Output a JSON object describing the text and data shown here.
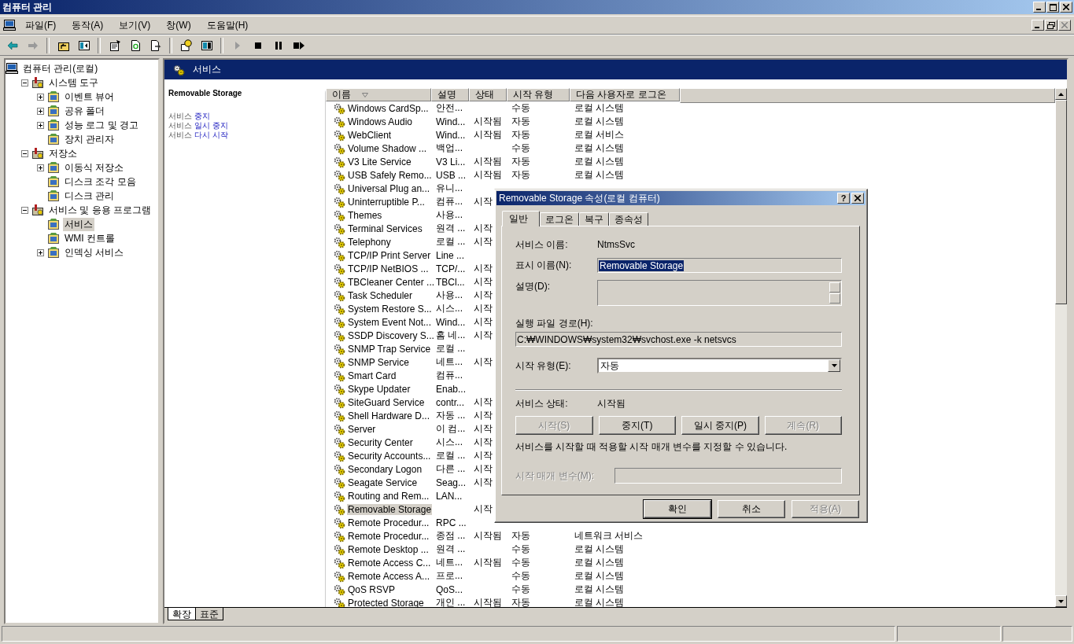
{
  "window": {
    "title": "컴퓨터 관리"
  },
  "menu": [
    "파일(F)",
    "동작(A)",
    "보기(V)",
    "창(W)",
    "도움말(H)"
  ],
  "toolbar": [
    {
      "disabled": false
    },
    {
      "disabled": true
    },
    {
      "disabled": false
    },
    {
      "disabled": false
    },
    {
      "disabled": false
    },
    {
      "disabled": false
    },
    {
      "disabled": false
    },
    {
      "disabled": false
    },
    {
      "disabled": false
    },
    {
      "disabled": true
    },
    {
      "disabled": false
    },
    {
      "disabled": false
    },
    {
      "disabled": false
    }
  ],
  "tree": [
    {
      "label": "컴퓨터 관리(로컬)",
      "selected": false,
      "children": [
        {
          "label": "시스템 도구",
          "expanded": true,
          "selected": false,
          "children": [
            {
              "label": "이벤트 뷰어",
              "expanded": false,
              "selected": false
            },
            {
              "label": "공유 폴더",
              "expanded": false,
              "selected": false
            },
            {
              "label": "성능 로그 및 경고",
              "expanded": false,
              "selected": false
            },
            {
              "label": "장치 관리자",
              "selected": false
            }
          ]
        },
        {
          "label": "저장소",
          "expanded": true,
          "selected": false,
          "children": [
            {
              "label": "이동식 저장소",
              "expanded": false,
              "selected": false
            },
            {
              "label": "디스크 조각 모음",
              "selected": false
            },
            {
              "label": "디스크 관리",
              "selected": false
            }
          ]
        },
        {
          "label": "서비스 및 응용 프로그램",
          "expanded": true,
          "selected": false,
          "children": [
            {
              "label": "서비스",
              "selected": true
            },
            {
              "label": "WMI 컨트롤",
              "selected": false
            },
            {
              "label": "인덱싱 서비스",
              "expanded": false,
              "selected": false
            }
          ]
        }
      ]
    }
  ],
  "pane_header": {
    "title": "서비스"
  },
  "description_pane": {
    "title": "Removable Storage",
    "links": [
      {
        "text": "서비스",
        "action": "중지"
      },
      {
        "text": "서비스",
        "action": "일시 중지"
      },
      {
        "text": "서비스",
        "action": "다시 시작"
      }
    ]
  },
  "table": {
    "columns": [
      {
        "label": "이름",
        "sorted": true
      },
      {
        "label": "설명",
        "sorted": false
      },
      {
        "label": "상태",
        "sorted": false
      },
      {
        "label": "시작 유형",
        "sorted": false
      },
      {
        "label": "다음 사용자로 로그온",
        "sorted": false
      }
    ],
    "rows": [
      {
        "name": "Windows CardSp...",
        "description": "안전...",
        "start_type": "수동",
        "logon": "로컬 시스템",
        "selected": false
      },
      {
        "name": "Windows Audio",
        "description": "Wind...",
        "status": "시작됨",
        "start_type": "자동",
        "logon": "로컬 시스템",
        "selected": false
      },
      {
        "name": "WebClient",
        "description": "Wind...",
        "status": "시작됨",
        "start_type": "자동",
        "logon": "로컬 서비스",
        "selected": false
      },
      {
        "name": "Volume Shadow ...",
        "description": "백업...",
        "start_type": "수동",
        "logon": "로컬 시스템",
        "selected": false
      },
      {
        "name": "V3 Lite Service",
        "description": "V3 Li...",
        "status": "시작됨",
        "start_type": "자동",
        "logon": "로컬 시스템",
        "selected": false
      },
      {
        "name": "USB Safely Remo...",
        "description": "USB ...",
        "status": "시작됨",
        "start_type": "자동",
        "logon": "로컬 시스템",
        "selected": false
      },
      {
        "name": "Universal Plug an...",
        "description": "유니...",
        "selected": false
      },
      {
        "name": "Uninterruptible P...",
        "description": "컴퓨...",
        "status": "시작",
        "selected": false
      },
      {
        "name": "Themes",
        "description": "사용...",
        "selected": false
      },
      {
        "name": "Terminal Services",
        "description": "원격 ...",
        "status": "시작",
        "selected": false
      },
      {
        "name": "Telephony",
        "description": "로컬 ...",
        "status": "시작",
        "selected": false
      },
      {
        "name": "TCP/IP Print Server",
        "description": "Line ...",
        "selected": false
      },
      {
        "name": "TCP/IP NetBIOS ...",
        "description": "TCP/...",
        "status": "시작",
        "selected": false
      },
      {
        "name": "TBCleaner Center ...",
        "description": "TBCl...",
        "status": "시작",
        "selected": false
      },
      {
        "name": "Task Scheduler",
        "description": "사용...",
        "status": "시작",
        "selected": false
      },
      {
        "name": "System Restore S...",
        "description": "시스...",
        "status": "시작",
        "selected": false
      },
      {
        "name": "System Event Not...",
        "description": "Wind...",
        "status": "시작",
        "selected": false
      },
      {
        "name": "SSDP Discovery S...",
        "description": "홈 네...",
        "status": "시작",
        "selected": false
      },
      {
        "name": "SNMP Trap Service",
        "description": "로컬 ...",
        "selected": false
      },
      {
        "name": "SNMP Service",
        "description": "네트...",
        "status": "시작",
        "selected": false
      },
      {
        "name": "Smart Card",
        "description": "컴퓨...",
        "selected": false
      },
      {
        "name": "Skype Updater",
        "description": "Enab...",
        "selected": false
      },
      {
        "name": "SiteGuard Service",
        "description": "contr...",
        "status": "시작",
        "selected": false
      },
      {
        "name": "Shell Hardware D...",
        "description": "자동 ...",
        "status": "시작",
        "selected": false
      },
      {
        "name": "Server",
        "description": "이 컴...",
        "status": "시작",
        "selected": false
      },
      {
        "name": "Security Center",
        "description": "시스...",
        "status": "시작",
        "selected": false
      },
      {
        "name": "Security Accounts...",
        "description": "로컬 ...",
        "status": "시작",
        "selected": false
      },
      {
        "name": "Secondary Logon",
        "description": "다른 ...",
        "status": "시작",
        "selected": false
      },
      {
        "name": "Seagate Service",
        "description": "Seag...",
        "status": "시작",
        "selected": false
      },
      {
        "name": "Routing and Rem...",
        "description": "LAN...",
        "selected": false
      },
      {
        "name": "Removable Storage",
        "status": "시작",
        "selected": true
      },
      {
        "name": "Remote Procedur...",
        "description": "RPC ...",
        "selected": false
      },
      {
        "name": "Remote Procedur...",
        "description": "종점 ...",
        "status": "시작됨",
        "start_type": "자동",
        "logon": "네트워크 서비스",
        "selected": false
      },
      {
        "name": "Remote Desktop ...",
        "description": "원격 ...",
        "start_type": "수동",
        "logon": "로컬 시스템",
        "selected": false
      },
      {
        "name": "Remote Access C...",
        "description": "네트...",
        "status": "시작됨",
        "start_type": "수동",
        "logon": "로컬 시스템",
        "selected": false
      },
      {
        "name": "Remote Access A...",
        "description": "프로...",
        "start_type": "수동",
        "logon": "로컬 시스템",
        "selected": false
      },
      {
        "name": "QoS RSVP",
        "description": "QoS...",
        "start_type": "수동",
        "logon": "로컬 시스템",
        "selected": false
      },
      {
        "name": "Protected Storage",
        "description": "개인 ...",
        "status": "시작됨",
        "start_type": "자동",
        "logon": "로컬 시스템",
        "selected": false
      }
    ]
  },
  "view_tabs": [
    {
      "label": "확장",
      "selected": true
    },
    {
      "label": "표준",
      "selected": false
    }
  ],
  "dialog": {
    "title": "Removable Storage 속성(로컬 컴퓨터)",
    "help_button": "?",
    "tabs": [
      {
        "label": "일반",
        "selected": true
      },
      {
        "label": "로그온",
        "selected": false
      },
      {
        "label": "복구",
        "selected": false
      },
      {
        "label": "종속성",
        "selected": false
      }
    ],
    "service_name_label": "서비스 이름:",
    "service_name": "NtmsSvc",
    "display_name_label": "표시 이름(N):",
    "display_name": {
      "value": "Removable Storage",
      "highlighted": true
    },
    "description_label": "설명(D):",
    "path_label": "실행 파일 경로(H):",
    "path": "C:₩WINDOWS₩system32₩svchost.exe -k netsvcs",
    "startup_type_label": "시작 유형(E):",
    "startup_type": "자동",
    "status_label": "서비스 상태:",
    "status": "시작됨",
    "service_buttons": [
      {
        "label": "시작(S)",
        "disabled": true
      },
      {
        "label": "중지(T)",
        "disabled": false
      },
      {
        "label": "일시 중지(P)",
        "disabled": false
      },
      {
        "label": "계속(R)",
        "disabled": true
      }
    ],
    "hint": "서비스를 시작할 때 적용할 시작 매개 변수를 지정할 수 있습니다.",
    "parameters_label": {
      "label": "시작 매개 변수(M):",
      "disabled": true
    },
    "buttons": [
      {
        "label": "확인",
        "disabled": false,
        "default": true
      },
      {
        "label": "취소",
        "disabled": false,
        "default": false
      },
      {
        "label": "적용(A)",
        "disabled": true,
        "default": false
      }
    ]
  }
}
